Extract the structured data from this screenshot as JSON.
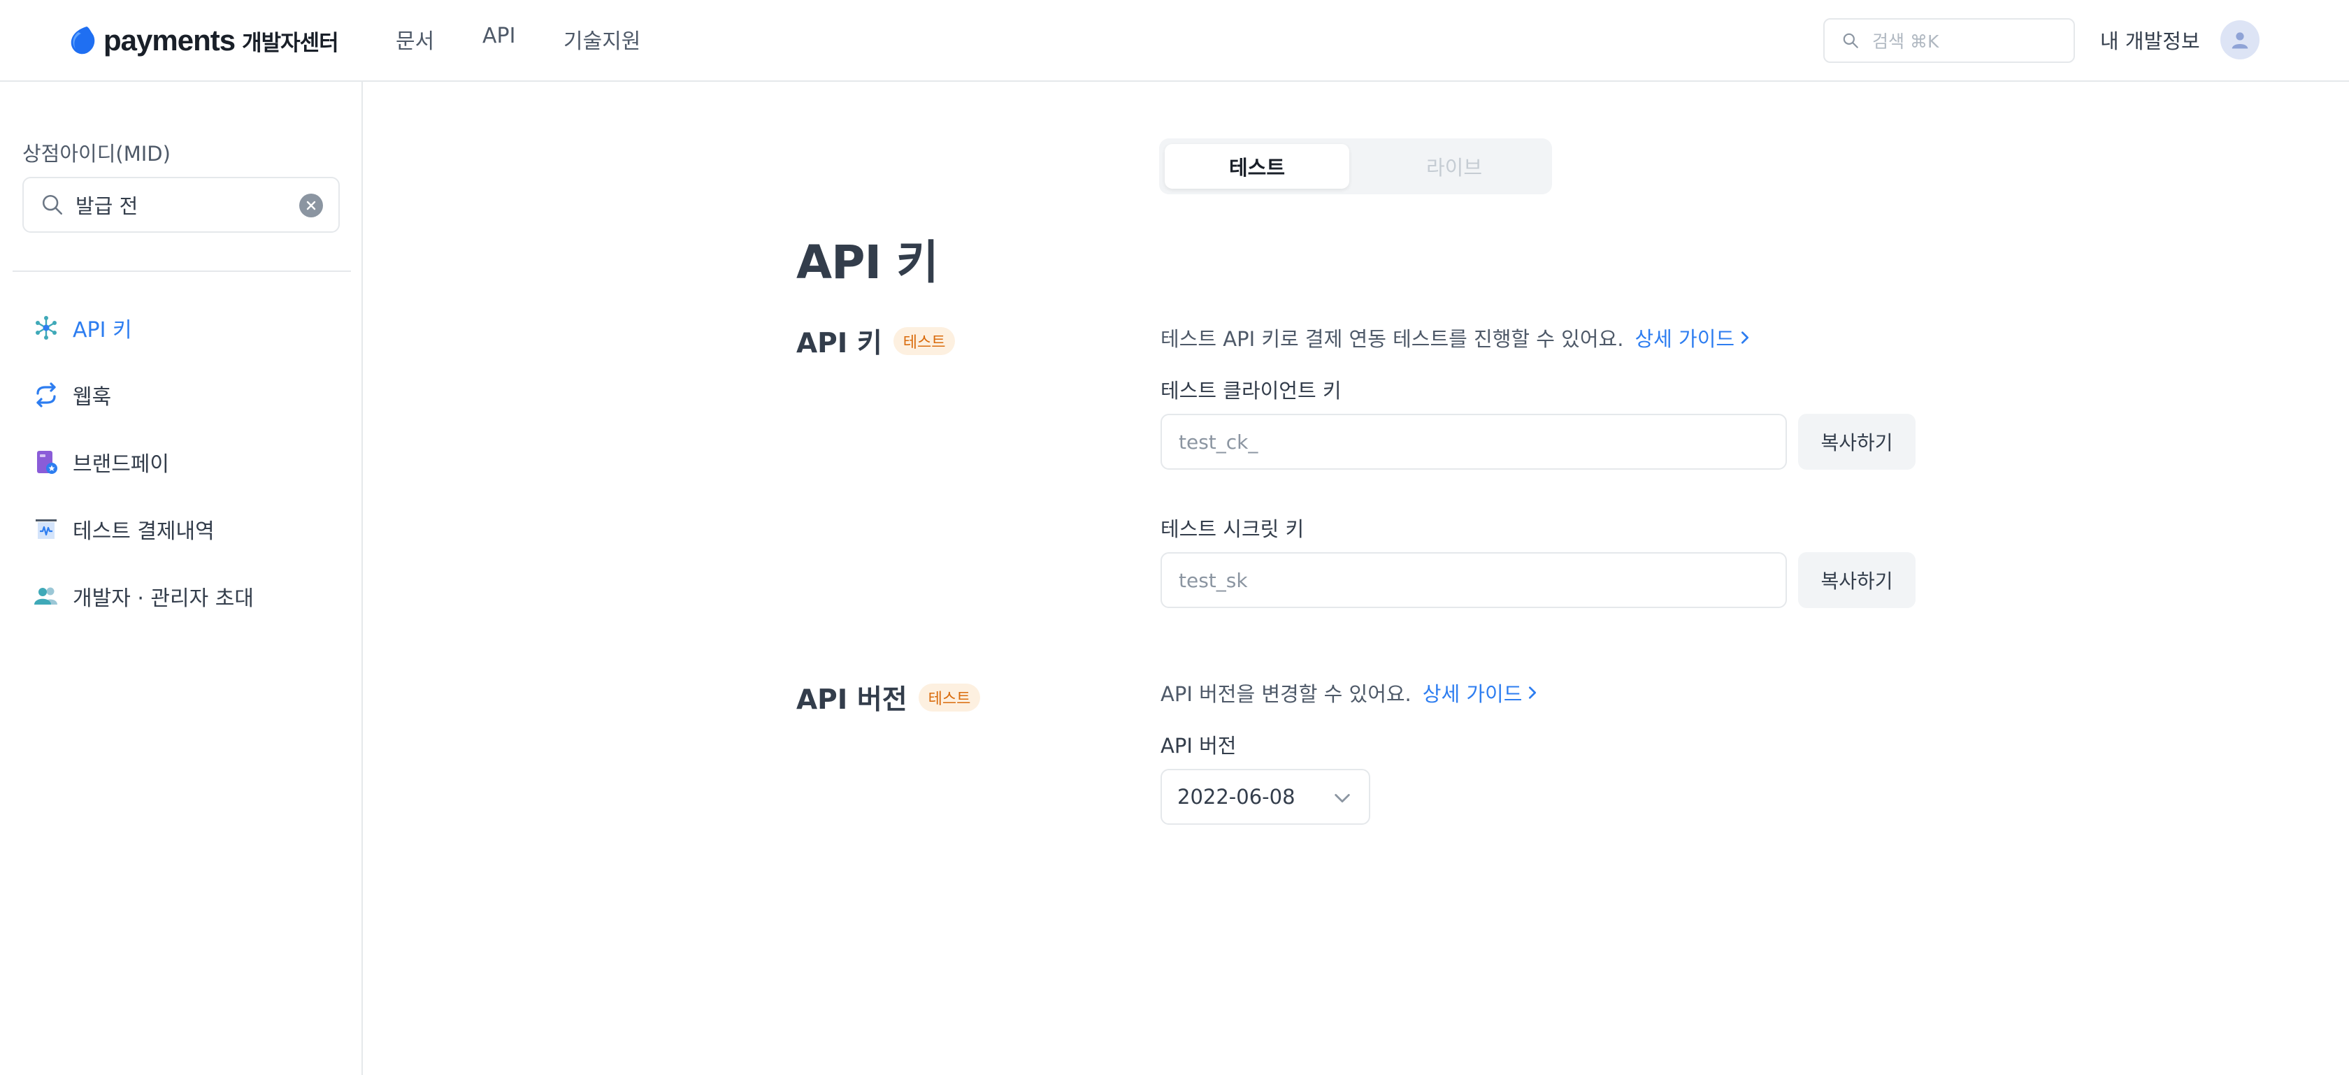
{
  "header": {
    "logo_word": "payments",
    "logo_sub": "개발자센터",
    "nav": [
      "문서",
      "API",
      "기술지원"
    ],
    "search_placeholder": "검색 ⌘K",
    "my_info": "내 개발정보"
  },
  "sidebar": {
    "mid_label": "상점아이디(MID)",
    "mid_value": "발급 전",
    "items": [
      {
        "label": "API 키",
        "icon": "api-key-icon",
        "active": true
      },
      {
        "label": "웹훅",
        "icon": "webhook-icon",
        "active": false
      },
      {
        "label": "브랜드페이",
        "icon": "brandpay-icon",
        "active": false
      },
      {
        "label": "테스트 결제내역",
        "icon": "receipt-icon",
        "active": false
      },
      {
        "label": "개발자 · 관리자 초대",
        "icon": "people-icon",
        "active": false
      }
    ]
  },
  "mode_toggle": {
    "test": "테스트",
    "live": "라이브",
    "selected": "test"
  },
  "page_title": "API 키",
  "api_keys": {
    "title": "API 키",
    "badge": "테스트",
    "description": "테스트 API 키로 결제 연동 테스트를 진행할 수 있어요.",
    "guide_link": "상세 가이드",
    "client_key_label": "테스트 클라이언트 키",
    "client_key_value": "test_ck_",
    "secret_key_label": "테스트 시크릿 키",
    "secret_key_value": "test_sk",
    "copy_label": "복사하기"
  },
  "api_version": {
    "title": "API 버전",
    "badge": "테스트",
    "description": "API 버전을 변경할 수 있어요.",
    "guide_link": "상세 가이드",
    "field_label": "API 버전",
    "selected_version": "2022-06-08"
  },
  "colors": {
    "accent": "#2d7df0",
    "badge_bg": "#fdf0e0",
    "badge_text": "#d96b0c",
    "border": "#e5e8eb"
  }
}
